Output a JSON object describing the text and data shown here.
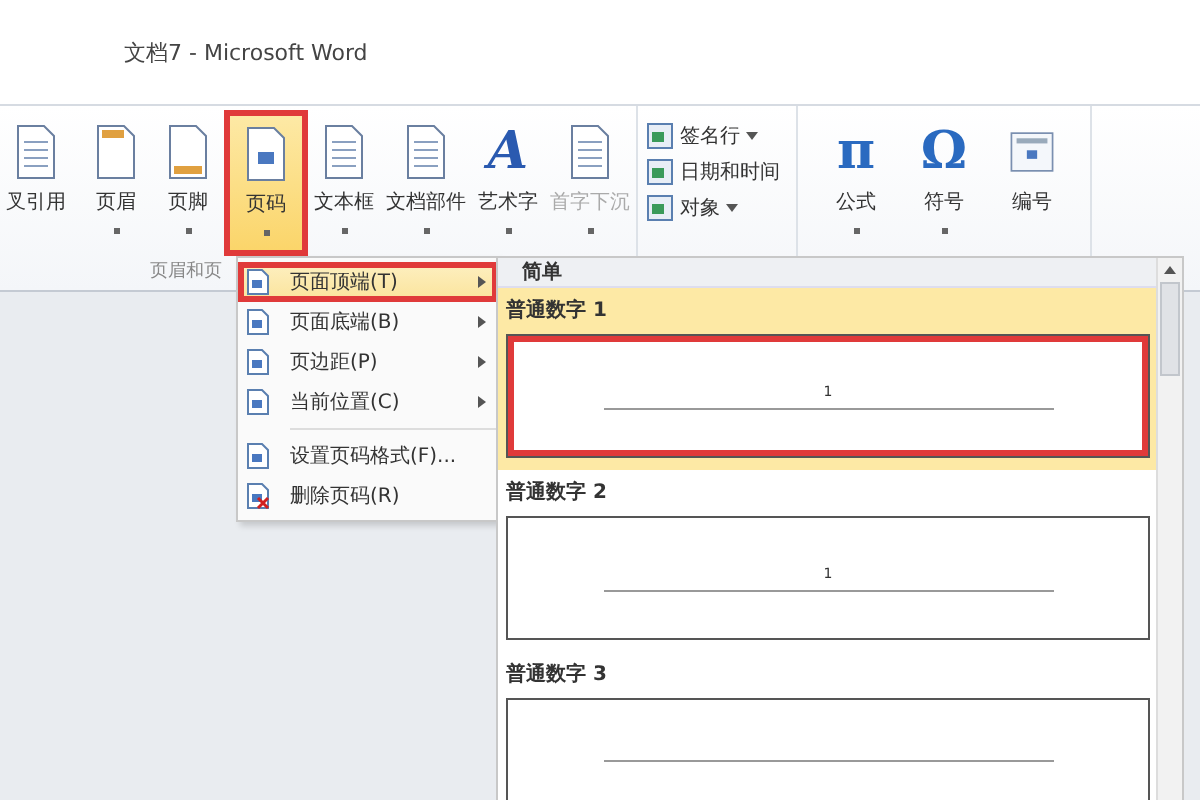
{
  "window": {
    "title": "文档7 - Microsoft Word"
  },
  "ribbon": {
    "buttons": [
      {
        "label": "叉引用",
        "dropdown": false,
        "selected": false,
        "disabled": false,
        "marked": false
      },
      {
        "label": "页眉",
        "dropdown": true,
        "selected": false,
        "disabled": false,
        "marked": false
      },
      {
        "label": "页脚",
        "dropdown": true,
        "selected": false,
        "disabled": false,
        "marked": false
      },
      {
        "label": "页码",
        "dropdown": true,
        "selected": true,
        "disabled": false,
        "marked": true
      },
      {
        "label": "文本框",
        "dropdown": true,
        "selected": false,
        "disabled": false,
        "marked": false
      },
      {
        "label": "文档部件",
        "dropdown": true,
        "selected": false,
        "disabled": false,
        "marked": false
      },
      {
        "label": "艺术字",
        "glyph": "A",
        "dropdown": true,
        "selected": false,
        "disabled": false,
        "marked": false
      },
      {
        "label": "首字下沉",
        "dropdown": true,
        "selected": false,
        "disabled": true,
        "marked": false
      }
    ],
    "small_buttons": [
      {
        "label": "签名行",
        "dropdown": true
      },
      {
        "label": "日期和时间",
        "dropdown": false
      },
      {
        "label": "对象",
        "dropdown": true
      }
    ],
    "symbol_buttons": [
      {
        "label": "公式",
        "glyph": "π",
        "dropdown": true
      },
      {
        "label": "符号",
        "glyph": "Ω",
        "dropdown": true
      },
      {
        "label": "编号",
        "dropdown": false
      }
    ],
    "group_label": "页眉和页"
  },
  "menu": {
    "items": [
      {
        "label": "页面顶端(T)",
        "submenu": true,
        "selected": true,
        "marked": true
      },
      {
        "label": "页面底端(B)",
        "submenu": true,
        "selected": false,
        "marked": false
      },
      {
        "label": "页边距(P)",
        "submenu": true,
        "selected": false,
        "marked": false
      },
      {
        "label": "当前位置(C)",
        "submenu": true,
        "selected": false,
        "marked": false
      },
      {
        "label": "设置页码格式(F)...",
        "submenu": false,
        "selected": false,
        "marked": false,
        "separator_before": true
      },
      {
        "label": "删除页码(R)",
        "submenu": false,
        "selected": false,
        "marked": false
      }
    ]
  },
  "gallery": {
    "header": "简单",
    "items": [
      {
        "label": "普通数字 1",
        "number": "1",
        "selected": true,
        "marked": true
      },
      {
        "label": "普通数字 2",
        "number": "1",
        "selected": false,
        "marked": false
      },
      {
        "label": "普通数字 3",
        "selected": false,
        "marked": false
      }
    ]
  }
}
